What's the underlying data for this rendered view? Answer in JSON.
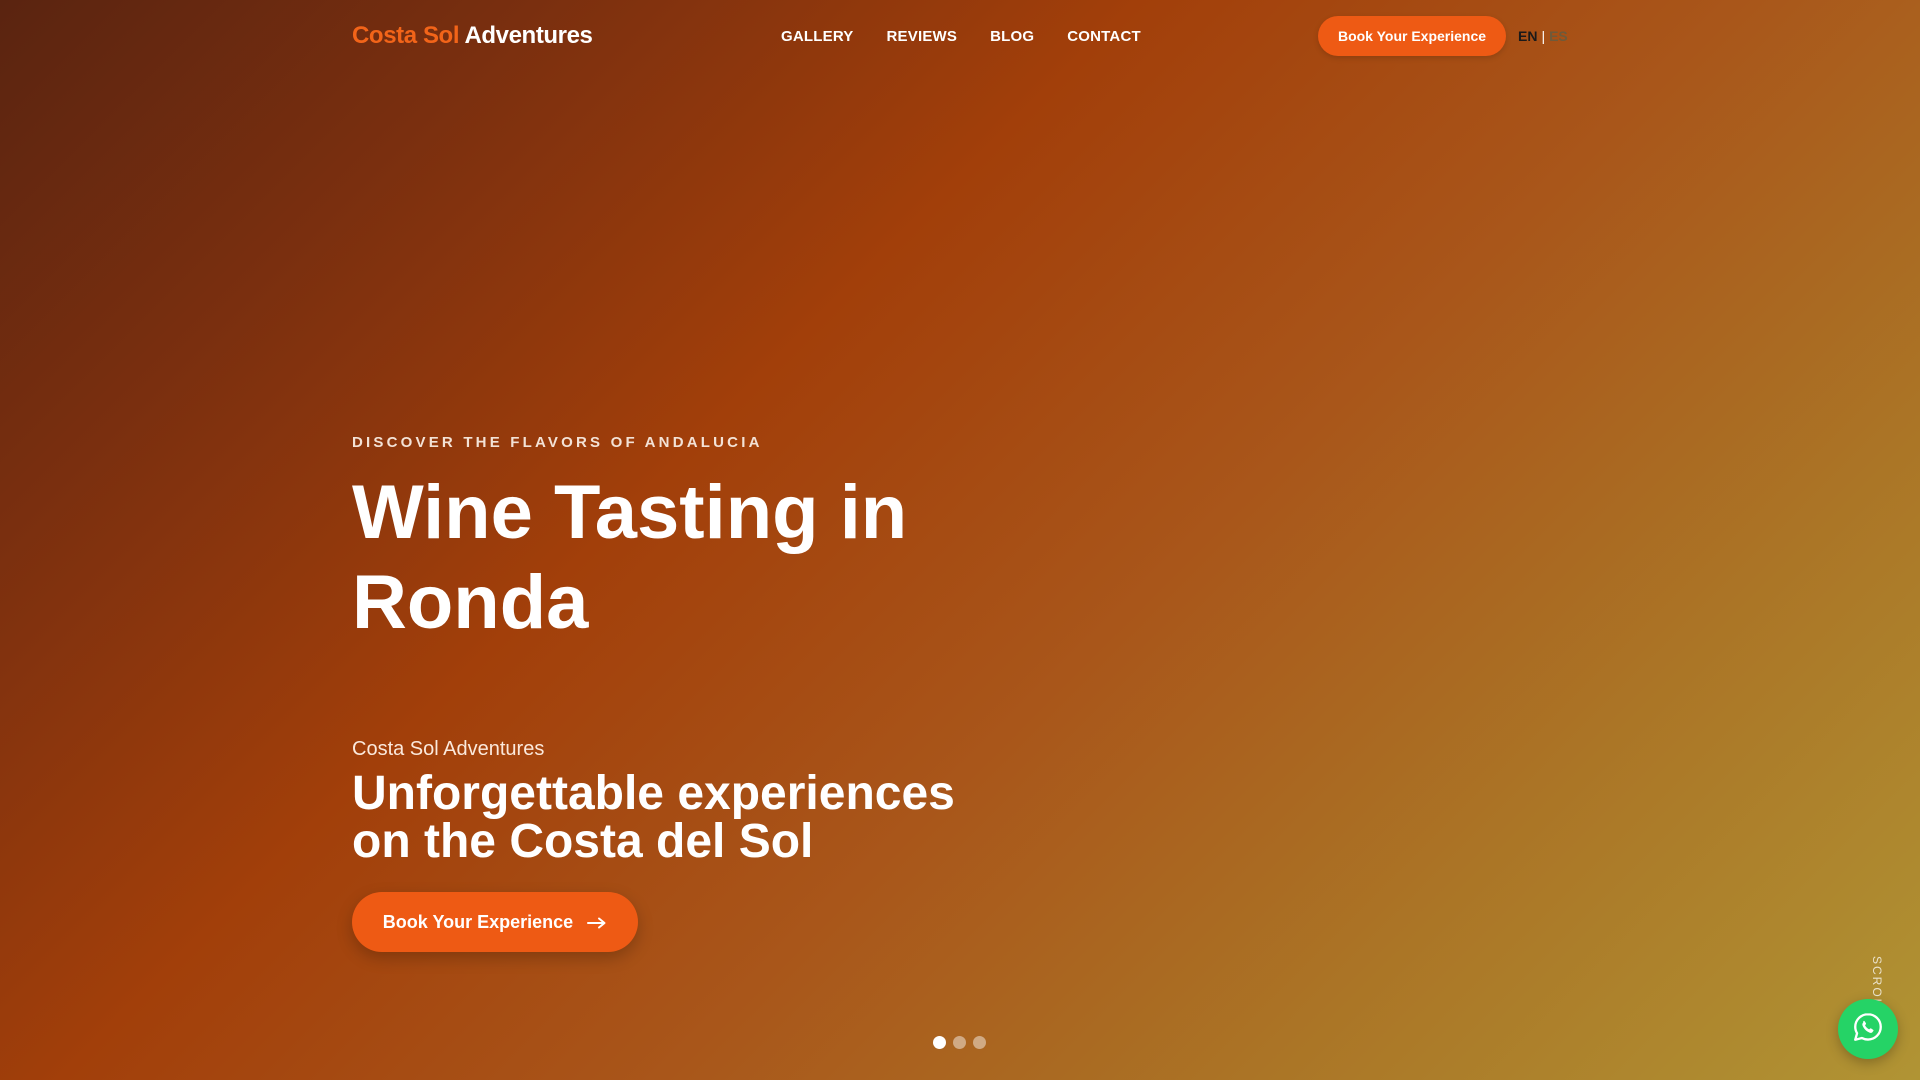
{
  "header": {
    "logo": {
      "accent": "Costa Sol",
      "rest": " Adventures",
      "accent_color": "#f26419"
    },
    "nav": [
      {
        "label": "GALLERY"
      },
      {
        "label": "REVIEWS"
      },
      {
        "label": "BLOG"
      },
      {
        "label": "CONTACT"
      }
    ],
    "cta_label": "Book Your Experience",
    "language": {
      "current": "EN",
      "separator": "|",
      "other": "ES"
    }
  },
  "hero": {
    "eyebrow": "DISCOVER THE FLAVORS OF ANDALUCIA",
    "title": "Wine Tasting in Ronda",
    "brand": "Costa Sol Adventures",
    "tagline": "Unforgettable experiences on the Costa del Sol",
    "cta_label": "Book Your Experience",
    "cta_icon": "arrow-right-icon"
  },
  "slider": {
    "total_slides": 3,
    "active_slide": 1
  },
  "scroll_hint": "SCROLL",
  "floating_button": {
    "icon": "whatsapp-icon",
    "color": "#25d366"
  },
  "colors": {
    "accent": "#ee5a14",
    "gradient_start": "#5a2410",
    "gradient_end": "#b09434"
  }
}
